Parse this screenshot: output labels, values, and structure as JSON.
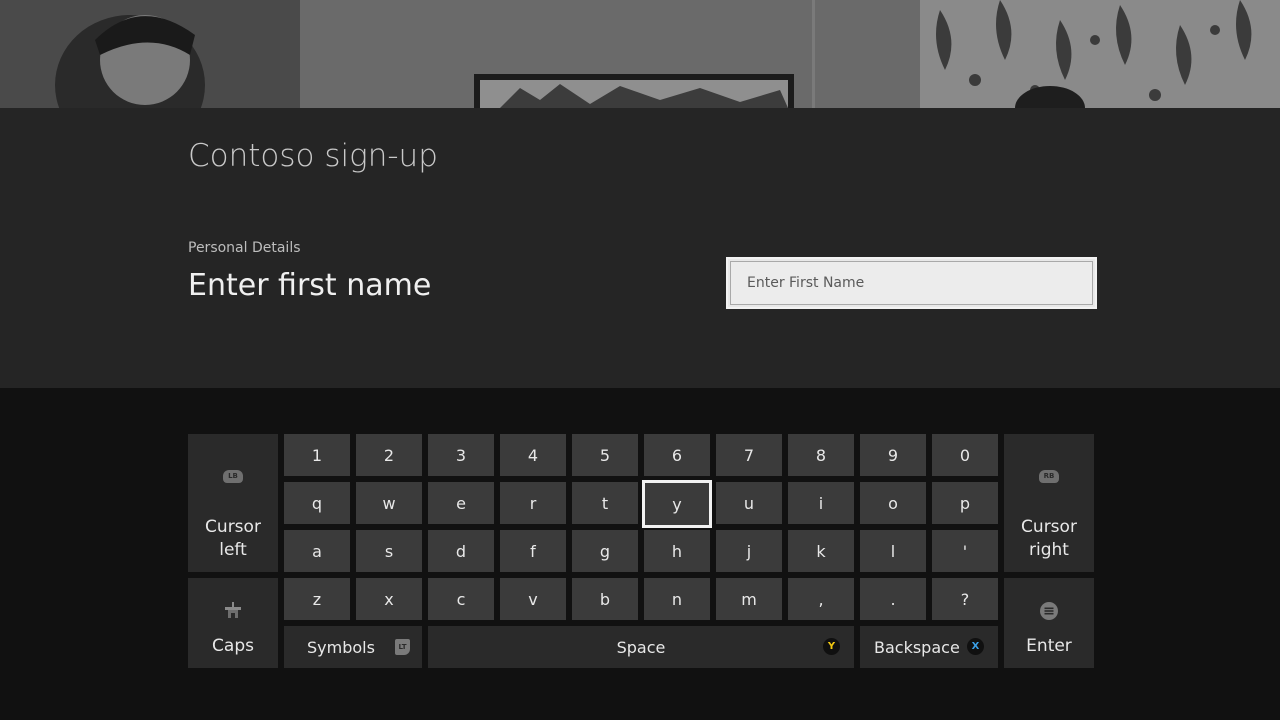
{
  "app": {
    "title": "Contoso sign-up"
  },
  "form": {
    "section_label": "Personal Details",
    "prompt": "Enter first name",
    "first_name": {
      "value": "",
      "placeholder": "Enter First Name"
    }
  },
  "keyboard": {
    "focused_key": "y",
    "rows": [
      [
        "1",
        "2",
        "3",
        "4",
        "5",
        "6",
        "7",
        "8",
        "9",
        "0"
      ],
      [
        "q",
        "w",
        "e",
        "r",
        "t",
        "y",
        "u",
        "i",
        "o",
        "p"
      ],
      [
        "a",
        "s",
        "d",
        "f",
        "g",
        "h",
        "j",
        "k",
        "l",
        "'"
      ],
      [
        "z",
        "x",
        "c",
        "v",
        "b",
        "n",
        "m",
        ",",
        ".",
        "?"
      ]
    ],
    "cursor_left": {
      "line1": "Cursor",
      "line2": "left",
      "hint": "LB"
    },
    "cursor_right": {
      "line1": "Cursor",
      "line2": "right",
      "hint": "RB"
    },
    "caps": {
      "label": "Caps"
    },
    "symbols": {
      "label": "Symbols",
      "hint": "LT"
    },
    "space": {
      "label": "Space",
      "hint": "Y",
      "hint_color": "#f2c811"
    },
    "backspace": {
      "label": "Backspace",
      "hint": "X",
      "hint_color": "#3a9ee4"
    },
    "enter": {
      "label": "Enter"
    }
  }
}
